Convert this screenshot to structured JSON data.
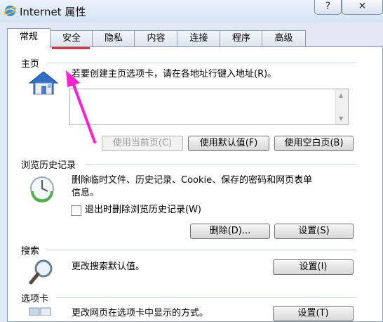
{
  "window": {
    "title": "Internet 属性",
    "help_label": "?",
    "close_label": "✕"
  },
  "tabs": [
    {
      "label": "常规",
      "active": true
    },
    {
      "label": "安全",
      "active": false
    },
    {
      "label": "隐私",
      "active": false
    },
    {
      "label": "内容",
      "active": false
    },
    {
      "label": "连接",
      "active": false
    },
    {
      "label": "程序",
      "active": false
    },
    {
      "label": "高级",
      "active": false
    }
  ],
  "homepage": {
    "title": "主页",
    "description": "若要创建主页选项卡，请在各地址行键入地址(R)。",
    "url_value": "",
    "buttons": {
      "use_current": "使用当前页(C)",
      "use_default": "使用默认值(F)",
      "use_blank": "使用空白页(B)"
    }
  },
  "history": {
    "title": "浏览历史记录",
    "description_line1": "删除临时文件、历史记录、Cookie、保存的密码和网页表单",
    "description_line2": "信息。",
    "checkbox_label": "退出时删除浏览历史记录(W)",
    "checkbox_checked": false,
    "delete_button": "删除(D)...",
    "settings_button": "设置(S)"
  },
  "search": {
    "title": "搜索",
    "description": "更改搜索默认值。",
    "settings_button": "设置(I)"
  },
  "tabbed": {
    "title": "选项卡",
    "description": "更改网页在选项卡中显示的方式。",
    "settings_button": "设置(T)"
  },
  "annotation": {
    "underline_color": "#e0313f",
    "arrow_color": "#ff1fd3"
  }
}
